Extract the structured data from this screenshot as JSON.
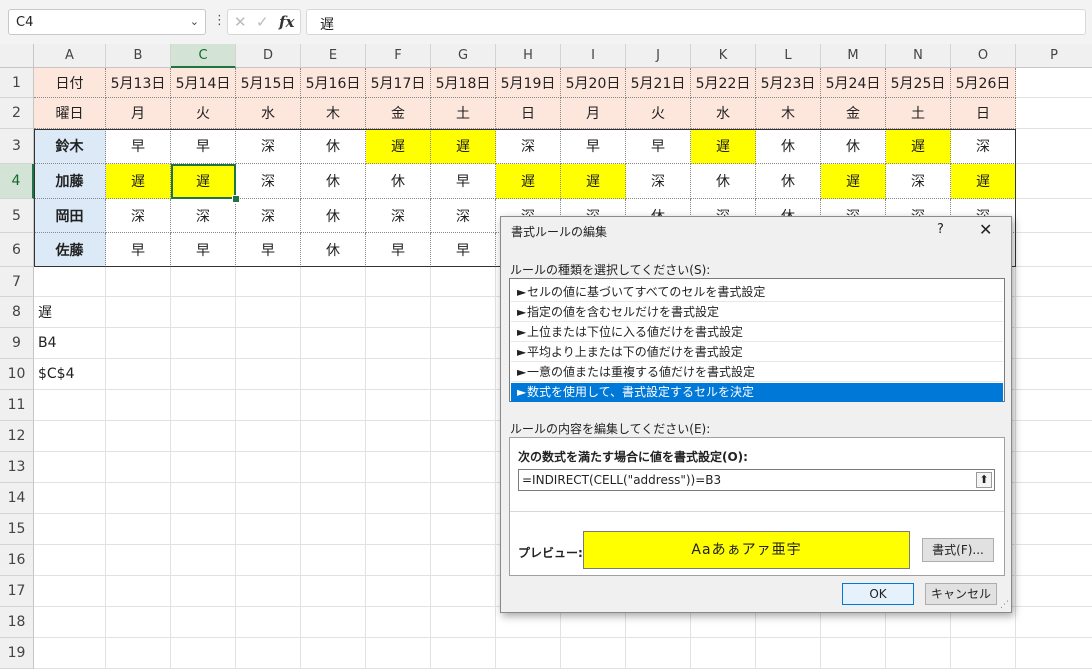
{
  "formula_bar": {
    "name_box": "C4",
    "name_box_arrow": "⌄",
    "dots": "⋮",
    "cancel_glyph": "✕",
    "enter_glyph": "✓",
    "fx": "fx",
    "value": "遅"
  },
  "columns": [
    "A",
    "B",
    "C",
    "D",
    "E",
    "F",
    "G",
    "H",
    "I",
    "J",
    "K",
    "L",
    "M",
    "N",
    "O",
    "P"
  ],
  "rows": [
    "1",
    "2",
    "3",
    "4",
    "5",
    "6",
    "7",
    "8",
    "9",
    "10",
    "11",
    "12",
    "13",
    "14",
    "15",
    "16",
    "17",
    "18",
    "19"
  ],
  "sheet": {
    "row1": [
      "日付",
      "5月13日",
      "5月14日",
      "5月15日",
      "5月16日",
      "5月17日",
      "5月18日",
      "5月19日",
      "5月20日",
      "5月21日",
      "5月22日",
      "5月23日",
      "5月24日",
      "5月25日",
      "5月26日"
    ],
    "row2": [
      "曜日",
      "月",
      "火",
      "水",
      "木",
      "金",
      "土",
      "日",
      "月",
      "火",
      "水",
      "木",
      "金",
      "土",
      "日"
    ],
    "row3": [
      "鈴木",
      "早",
      "早",
      "深",
      "休",
      "遅",
      "遅",
      "深",
      "早",
      "早",
      "遅",
      "休",
      "休",
      "遅",
      "深"
    ],
    "row4": [
      "加藤",
      "遅",
      "遅",
      "深",
      "休",
      "休",
      "早",
      "遅",
      "遅",
      "深",
      "休",
      "休",
      "遅",
      "深",
      "遅"
    ],
    "row5": [
      "岡田",
      "深",
      "深",
      "深",
      "休",
      "深",
      "深",
      "深",
      "深",
      "休",
      "深",
      "休",
      "深",
      "深",
      "深"
    ],
    "row6": [
      "佐藤",
      "早",
      "早",
      "早",
      "休",
      "早",
      "早"
    ],
    "a8": "遅",
    "a9": "B4",
    "a10": "$C$4"
  },
  "highlight_color": "#ffff00",
  "dialog": {
    "title": "書式ルールの編集",
    "help": "?",
    "close": "✕",
    "rule_type_label": "ルールの種類を選択してください(S):",
    "rule_types": [
      "セルの値に基づいてすべてのセルを書式設定",
      "指定の値を含むセルだけを書式設定",
      "上位または下位に入る値だけを書式設定",
      "平均より上または下の値だけを書式設定",
      "一意の値または重複する値だけを書式設定",
      "数式を使用して、書式設定するセルを決定"
    ],
    "rule_arrow": "►",
    "edit_label": "ルールの内容を編集してください(E):",
    "formula_condition_label": "次の数式を満たす場合に値を書式設定(O):",
    "formula": "=INDIRECT(CELL(\"address\"))=B3",
    "collapse_glyph": "⬆",
    "preview_label": "プレビュー:",
    "preview_text": "Aaあぁアァ亜宇",
    "format_button": "書式(F)...",
    "ok_button": "OK",
    "cancel_button": "キャンセル",
    "grip": "⋰"
  }
}
